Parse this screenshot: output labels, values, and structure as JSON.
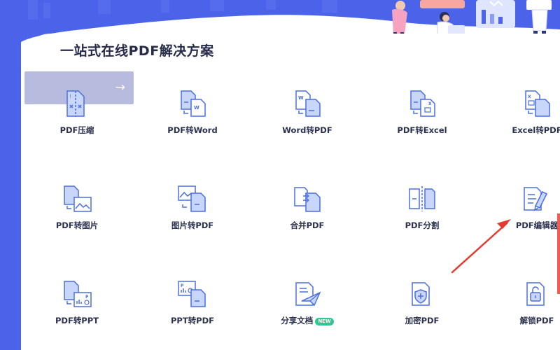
{
  "page_title": "一站式在线PDF解决方案",
  "colors": {
    "brand_blue": "#4a63e8",
    "icon_blue": "#4a6ee0",
    "icon_fill": "#c8d6fb",
    "new_badge": "#2cc98f",
    "annotation_red": "#e53a30"
  },
  "promo": {
    "arrow_icon": "arrow-right-icon"
  },
  "tools": [
    {
      "id": "pdf-compress",
      "label": "PDF压缩",
      "icon": "compress-icon"
    },
    {
      "id": "pdf-to-word",
      "label": "PDF转Word",
      "icon": "pdf-to-word-icon"
    },
    {
      "id": "word-to-pdf",
      "label": "Word转PDF",
      "icon": "word-to-pdf-icon"
    },
    {
      "id": "pdf-to-excel",
      "label": "PDF转Excel",
      "icon": "pdf-to-excel-icon"
    },
    {
      "id": "excel-to-pdf",
      "label": "Excel转PDF",
      "icon": "excel-to-pdf-icon"
    },
    {
      "id": "pdf-to-image",
      "label": "PDF转图片",
      "icon": "pdf-to-image-icon"
    },
    {
      "id": "image-to-pdf",
      "label": "图片转PDF",
      "icon": "image-to-pdf-icon"
    },
    {
      "id": "merge-pdf",
      "label": "合并PDF",
      "icon": "merge-icon"
    },
    {
      "id": "split-pdf",
      "label": "PDF分割",
      "icon": "split-icon"
    },
    {
      "id": "pdf-editor",
      "label": "PDF编辑器",
      "icon": "edit-icon"
    },
    {
      "id": "pdf-to-ppt",
      "label": "PDF转PPT",
      "icon": "pdf-to-ppt-icon"
    },
    {
      "id": "ppt-to-pdf",
      "label": "PPT转PDF",
      "icon": "ppt-to-pdf-icon"
    },
    {
      "id": "share-doc",
      "label": "分享文档",
      "icon": "share-icon",
      "badge": "NEW"
    },
    {
      "id": "encrypt-pdf",
      "label": "加密PDF",
      "icon": "encrypt-icon"
    },
    {
      "id": "unlock-pdf",
      "label": "解锁PDF",
      "icon": "unlock-icon"
    }
  ]
}
